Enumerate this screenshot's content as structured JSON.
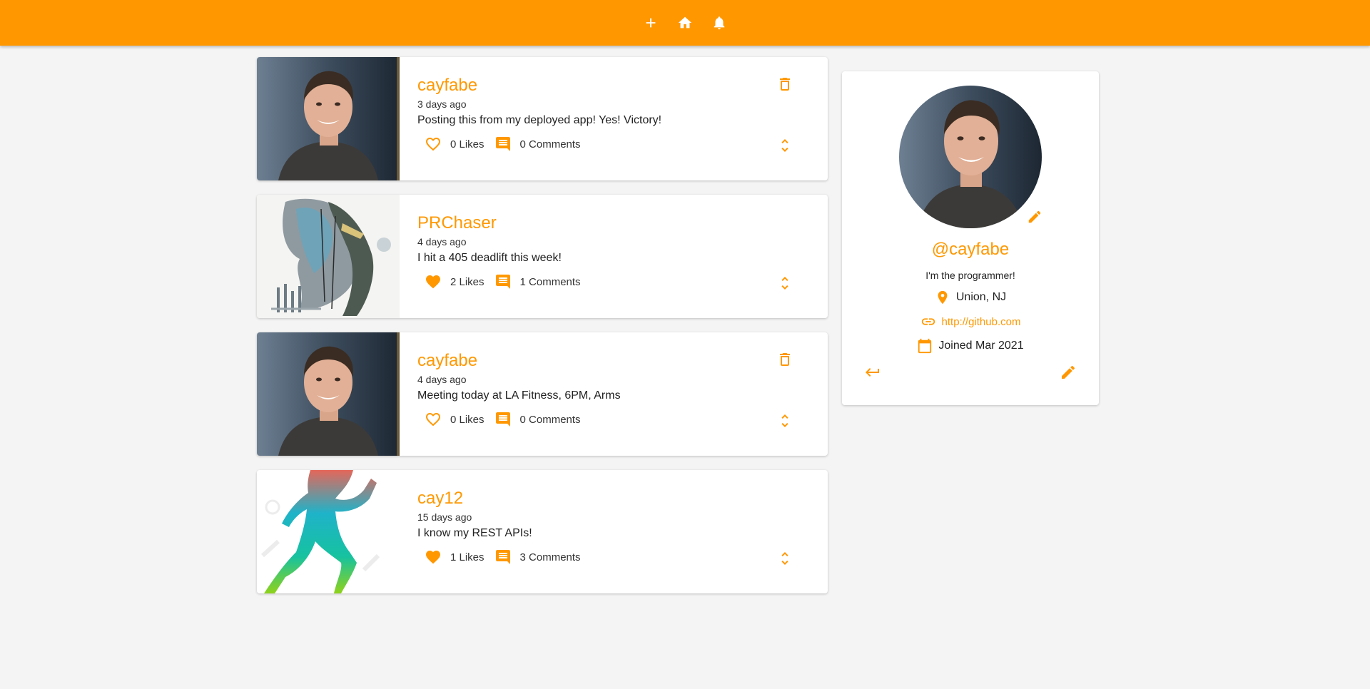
{
  "appbar": {
    "buttons": [
      {
        "name": "add-post-button",
        "icon": "plus-icon"
      },
      {
        "name": "home-button",
        "icon": "home-icon"
      },
      {
        "name": "notifications-button",
        "icon": "bell-icon"
      }
    ],
    "color": "#ff9800"
  },
  "posts": [
    {
      "handle": "cayfabe",
      "when": "3 days ago",
      "text": "Posting this from my deployed app! Yes! Victory!",
      "likes": "0 Likes",
      "comments": "0 Comments",
      "liked": false,
      "deletable": true,
      "image": "man-portrait"
    },
    {
      "handle": "PRChaser",
      "when": "4 days ago",
      "text": "I hit a 405 deadlift this week!",
      "likes": "2 Likes",
      "comments": "1 Comments",
      "liked": true,
      "deletable": false,
      "image": "illustrated-character"
    },
    {
      "handle": "cayfabe",
      "when": "4 days ago",
      "text": "Meeting today at LA Fitness, 6PM, Arms",
      "likes": "0 Likes",
      "comments": "0 Comments",
      "liked": false,
      "deletable": true,
      "image": "man-portrait"
    },
    {
      "handle": "cay12",
      "when": "15 days ago",
      "text": "I know my REST APIs!",
      "likes": "1 Likes",
      "comments": "3 Comments",
      "liked": true,
      "deletable": false,
      "image": "runner-silhouette"
    }
  ],
  "profile": {
    "handle": "@cayfabe",
    "bio": "I'm the programmer!",
    "location": "Union, NJ",
    "website": "http://github.com",
    "joined": "Joined Mar 2021"
  }
}
